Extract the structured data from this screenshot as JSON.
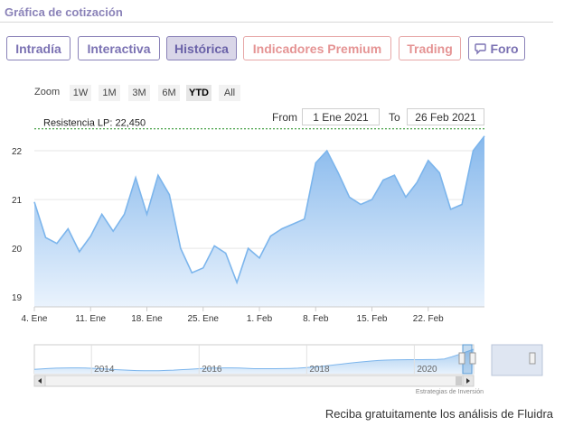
{
  "header": {
    "title": "Gráfica de cotización"
  },
  "tabs": [
    {
      "label": "Intradía",
      "active": false,
      "premium": false
    },
    {
      "label": "Interactiva",
      "active": false,
      "premium": false
    },
    {
      "label": "Histórica",
      "active": true,
      "premium": false
    },
    {
      "label": "Indicadores Premium",
      "active": false,
      "premium": true
    },
    {
      "label": "Trading",
      "active": false,
      "premium": true
    },
    {
      "label": "Foro",
      "active": false,
      "premium": false,
      "icon": "chat-icon"
    }
  ],
  "zoom": {
    "label": "Zoom",
    "options": [
      "1W",
      "1M",
      "3M",
      "6M",
      "YTD",
      "All"
    ],
    "selected": "YTD"
  },
  "range": {
    "from_label": "From",
    "from_value": "1 Ene 2021",
    "to_label": "To",
    "to_value": "26 Feb 2021"
  },
  "chart_data": {
    "type": "area",
    "title": "",
    "xlabel": "",
    "ylabel": "",
    "ylim": [
      18.8,
      22.5
    ],
    "y_ticks": [
      "22",
      "21",
      "20",
      "19"
    ],
    "x_ticks": [
      "4. Ene",
      "11. Ene",
      "18. Ene",
      "25. Ene",
      "1. Feb",
      "8. Feb",
      "15. Feb",
      "22. Feb"
    ],
    "x": [
      "4. Ene",
      "5. Ene",
      "6. Ene",
      "7. Ene",
      "8. Ene",
      "11. Ene",
      "12. Ene",
      "13. Ene",
      "14. Ene",
      "15. Ene",
      "18. Ene",
      "19. Ene",
      "20. Ene",
      "21. Ene",
      "22. Ene",
      "25. Ene",
      "26. Ene",
      "27. Ene",
      "28. Ene",
      "29. Ene",
      "1. Feb",
      "2. Feb",
      "3. Feb",
      "4. Feb",
      "5. Feb",
      "8. Feb",
      "9. Feb",
      "10. Feb",
      "11. Feb",
      "12. Feb",
      "15. Feb",
      "16. Feb",
      "17. Feb",
      "18. Feb",
      "19. Feb",
      "22. Feb",
      "23. Feb",
      "24. Feb",
      "25. Feb",
      "26. Feb"
    ],
    "values": [
      20.95,
      20.22,
      20.1,
      20.4,
      19.93,
      20.25,
      20.7,
      20.35,
      20.7,
      21.45,
      20.7,
      21.5,
      21.1,
      20.0,
      19.5,
      19.6,
      20.05,
      19.9,
      19.3,
      20.0,
      19.8,
      20.25,
      20.4,
      20.5,
      20.6,
      21.75,
      22.0,
      21.55,
      21.05,
      20.9,
      21.0,
      21.4,
      21.5,
      21.05,
      21.35,
      21.8,
      21.55,
      20.8,
      20.9,
      22.0,
      22.3
    ],
    "resistance": {
      "label": "Resistencia LP: 22,450",
      "value": 22.45
    },
    "grid": true,
    "navigator": {
      "years": [
        "2014",
        "2016",
        "2018",
        "2020"
      ]
    },
    "credits": "Estrategias de Inversión"
  },
  "footer": {
    "text": "Reciba gratuitamente los análisis de Fluidra"
  },
  "colors": {
    "accent": "#8a82b8",
    "series": "#7cb5ec",
    "area_top": "#86b8ec",
    "area_bottom": "#eaf3fd",
    "resistance": "#1a8a1a"
  }
}
